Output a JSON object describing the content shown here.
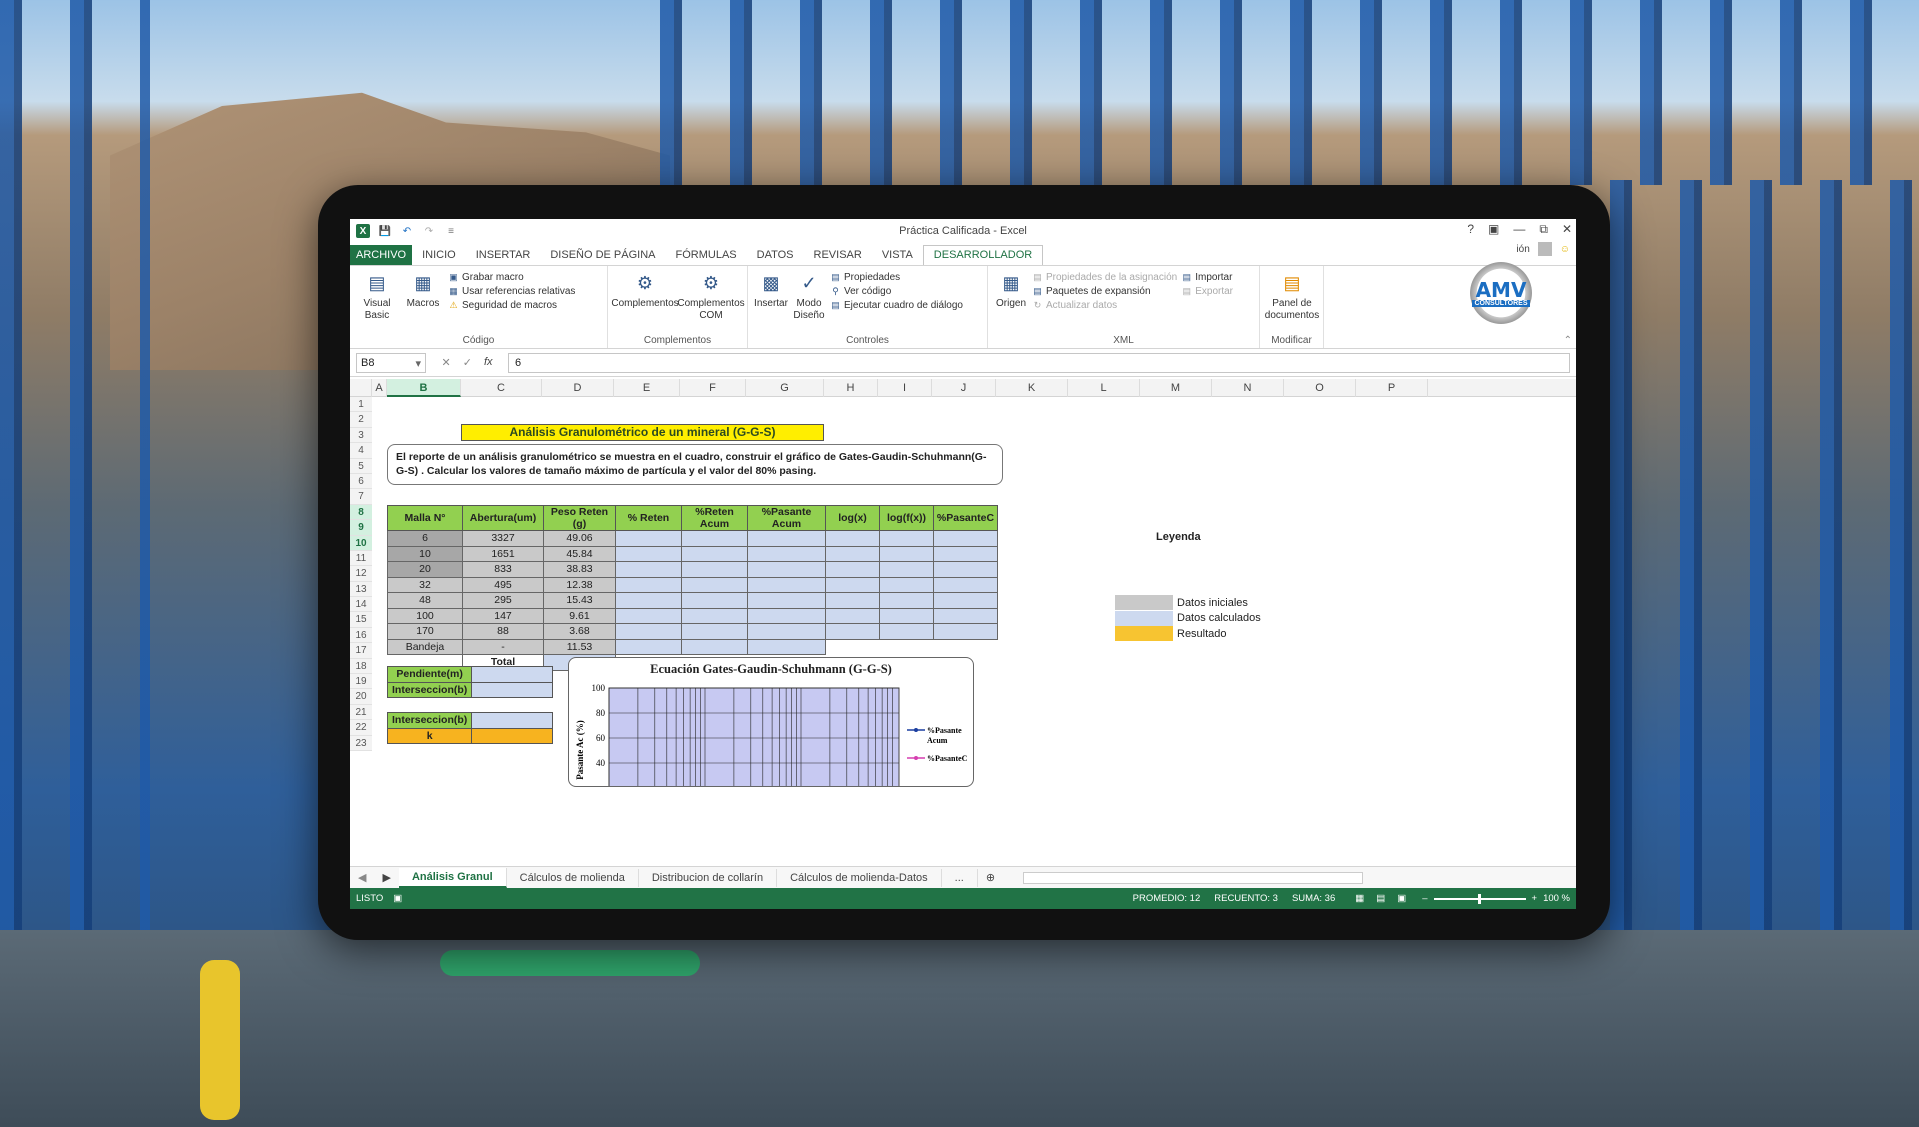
{
  "window": {
    "title": "Práctica Calificada - Excel",
    "help": "?",
    "user_label": "ión"
  },
  "ribbon_tabs": [
    "ARCHIVO",
    "INICIO",
    "INSERTAR",
    "DISEÑO DE PÁGINA",
    "FÓRMULAS",
    "DATOS",
    "REVISAR",
    "VISTA",
    "DESARROLLADOR"
  ],
  "ribbon": {
    "codigo": {
      "label": "Código",
      "visual_basic": "Visual Basic",
      "macros": "Macros",
      "grabar": "Grabar macro",
      "usar_ref": "Usar referencias relativas",
      "seguridad": "Seguridad de macros"
    },
    "complementos": {
      "label": "Complementos",
      "complementos": "Complementos",
      "com": "Complementos COM"
    },
    "controles": {
      "label": "Controles",
      "insertar": "Insertar",
      "modo": "Modo Diseño",
      "propiedades": "Propiedades",
      "ver_codigo": "Ver código",
      "ejecutar": "Ejecutar cuadro de diálogo"
    },
    "xml": {
      "label": "XML",
      "origen": "Origen",
      "prop_asig": "Propiedades de la asignación",
      "paquetes": "Paquetes de expansión",
      "actualizar": "Actualizar datos",
      "importar": "Importar",
      "exportar": "Exportar"
    },
    "modificar": {
      "label": "Modificar",
      "panel": "Panel de documentos"
    }
  },
  "logo": {
    "top": "AMV",
    "bottom": "CONSULTORES"
  },
  "formula_bar": {
    "name_box": "B8",
    "value": "6",
    "fx": "fx"
  },
  "columns": [
    "A",
    "B",
    "C",
    "D",
    "E",
    "F",
    "G",
    "H",
    "I",
    "J",
    "K",
    "L",
    "M",
    "N",
    "O",
    "P"
  ],
  "rows": [
    "1",
    "2",
    "3",
    "4",
    "5",
    "6",
    "7",
    "8",
    "9",
    "10",
    "11",
    "12",
    "13",
    "14",
    "15",
    "16",
    "17",
    "18",
    "19",
    "20",
    "21",
    "22",
    "23"
  ],
  "sheet": {
    "title": "Análisis Granulométrico de un mineral (G-G-S)",
    "description": "El reporte de un análisis granulométrico se muestra en el cuadro, construir el gráfico de Gates-Gaudin-Schuhmann(G-G-S) . Calcular los valores de tamaño máximo de partícula y el valor del 80% pasing.",
    "headers": [
      "Malla N°",
      "Abertura(um)",
      "Peso Reten (g)",
      "% Reten",
      "%Reten Acum",
      "%Pasante Acum",
      "log(x)",
      "log(f(x))",
      "%PasanteC"
    ],
    "table_rows": [
      [
        "6",
        "3327",
        "49.06"
      ],
      [
        "10",
        "1651",
        "45.84"
      ],
      [
        "20",
        "833",
        "38.83"
      ],
      [
        "32",
        "495",
        "12.38"
      ],
      [
        "48",
        "295",
        "15.43"
      ],
      [
        "100",
        "147",
        "9.61"
      ],
      [
        "170",
        "88",
        "3.68"
      ],
      [
        "Bandeja",
        "-",
        "11.53"
      ]
    ],
    "total_label": "Total",
    "pendiente": "Pendiente(m)",
    "interseccion": "Interseccion(b)",
    "interseccion2": "Interseccion(b)",
    "k": "k",
    "legend_title": "Leyenda",
    "legend": [
      {
        "label": "Datos iniciales",
        "color": "#c9c9c9"
      },
      {
        "label": "Datos calculados",
        "color": "#cdd9ef"
      },
      {
        "label": "Resultado",
        "color": "#f7c431"
      }
    ]
  },
  "chart_data": {
    "type": "line",
    "title": "Ecuación Gates-Gaudin-Schuhmann (G-G-S)",
    "ylabel": "Pasante Ac (%)",
    "y_ticks": [
      "100",
      "80",
      "60",
      "40"
    ],
    "ylim": [
      40,
      100
    ],
    "series": [
      {
        "name": "%Pasante Acum",
        "values": []
      },
      {
        "name": "%PasanteC",
        "values": []
      }
    ]
  },
  "sheet_tabs": [
    "Análisis Granul",
    "Cálculos de molienda",
    "Distribucion de collarín",
    "Cálculos de molienda-Datos"
  ],
  "sheet_tabs_more": "...",
  "status": {
    "mode": "LISTO",
    "promedio": "PROMEDIO: 12",
    "recuento": "RECUENTO: 3",
    "suma": "SUMA: 36",
    "zoom": "100 %"
  }
}
